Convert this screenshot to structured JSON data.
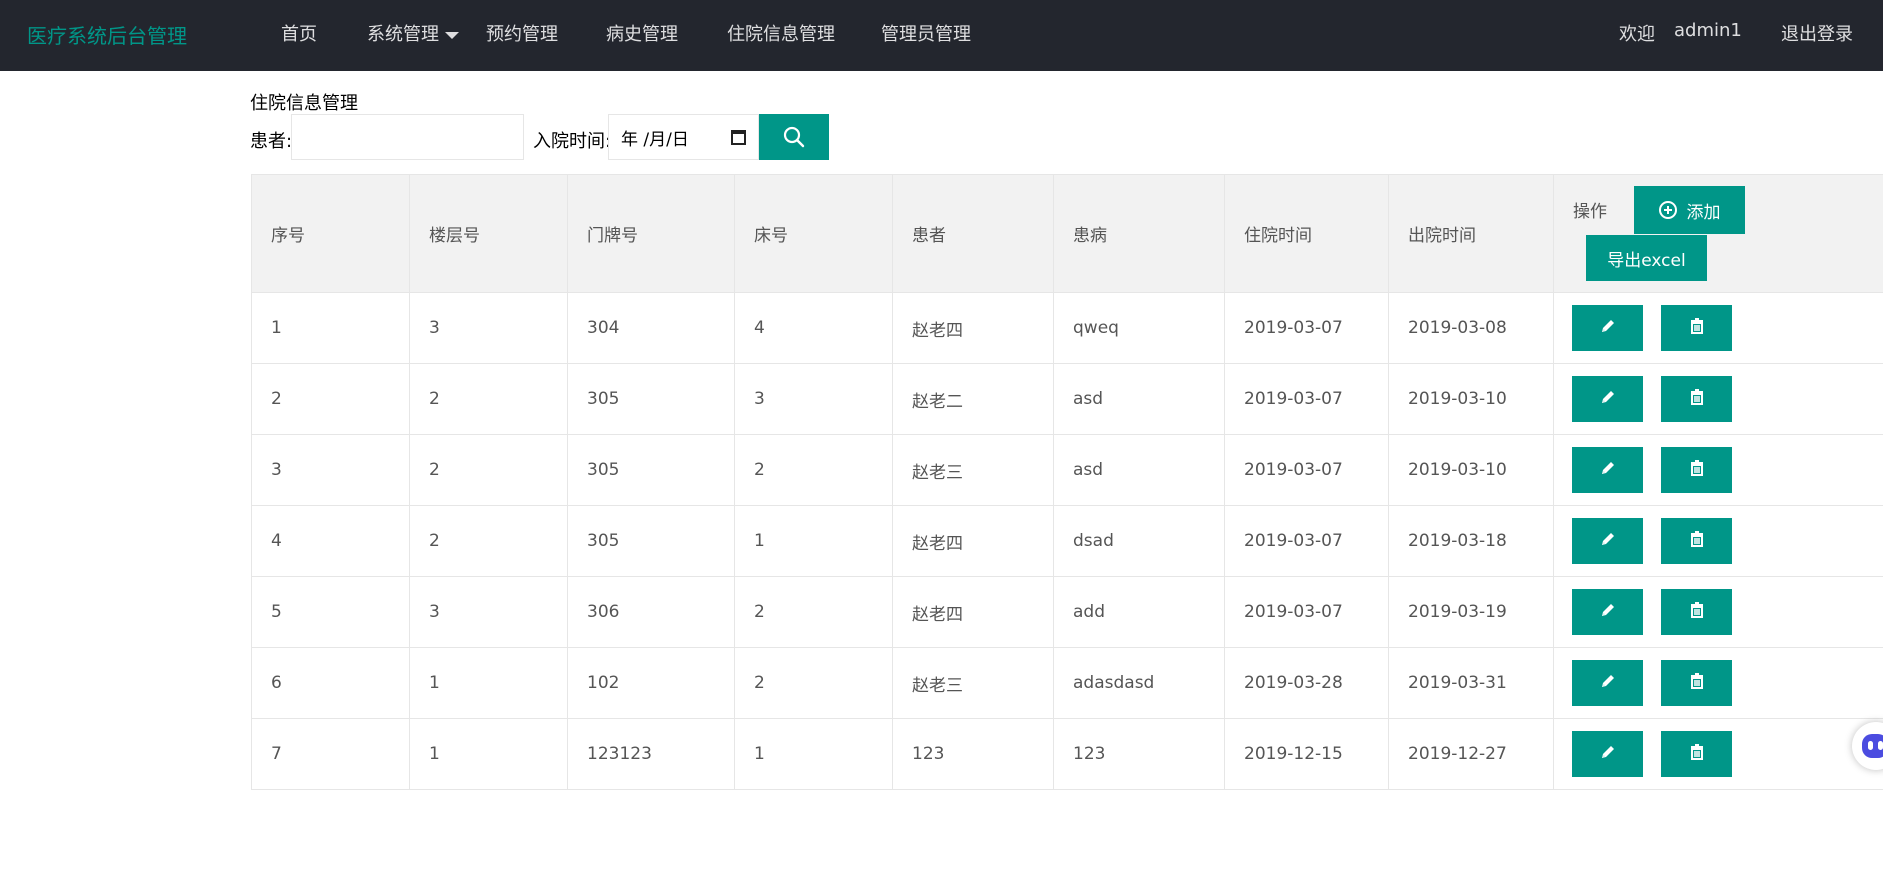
{
  "header": {
    "logo": "医疗系统后台管理",
    "nav": [
      "首页",
      "系统管理",
      "预约管理",
      "病史管理",
      "住院信息管理",
      "管理员管理"
    ],
    "welcome": "欢迎",
    "user": "admin1",
    "logout": "退出登录"
  },
  "page": {
    "title": "住院信息管理",
    "patient_label": "患者:",
    "patient_value": "",
    "date_label": "入院时间:",
    "date_placeholder": "年 /月/日"
  },
  "table": {
    "columns": [
      "序号",
      "楼层号",
      "门牌号",
      "床号",
      "患者",
      "患病",
      "住院时间",
      "出院时间",
      "操作"
    ],
    "add_label": "添加",
    "export_label": "导出excel",
    "rows": [
      [
        "1",
        "3",
        "304",
        "4",
        "赵老四",
        "qweq",
        "2019-03-07",
        "2019-03-08"
      ],
      [
        "2",
        "2",
        "305",
        "3",
        "赵老二",
        "asd",
        "2019-03-07",
        "2019-03-10"
      ],
      [
        "3",
        "2",
        "305",
        "2",
        "赵老三",
        "asd",
        "2019-03-07",
        "2019-03-10"
      ],
      [
        "4",
        "2",
        "305",
        "1",
        "赵老四",
        "dsad",
        "2019-03-07",
        "2019-03-18"
      ],
      [
        "5",
        "3",
        "306",
        "2",
        "赵老四",
        "add",
        "2019-03-07",
        "2019-03-19"
      ],
      [
        "6",
        "1",
        "102",
        "2",
        "赵老三",
        "adasdasd",
        "2019-03-28",
        "2019-03-31"
      ],
      [
        "7",
        "1",
        "123123",
        "1",
        "123",
        "123",
        "2019-12-15",
        "2019-12-27"
      ]
    ]
  },
  "colors": {
    "header_bg": "#23262e",
    "accent": "#009688"
  },
  "icons": {
    "search": "search-icon",
    "add": "plus-circle-icon",
    "edit": "pencil-icon",
    "delete": "trash-icon",
    "float": "assistant-bot-icon"
  }
}
